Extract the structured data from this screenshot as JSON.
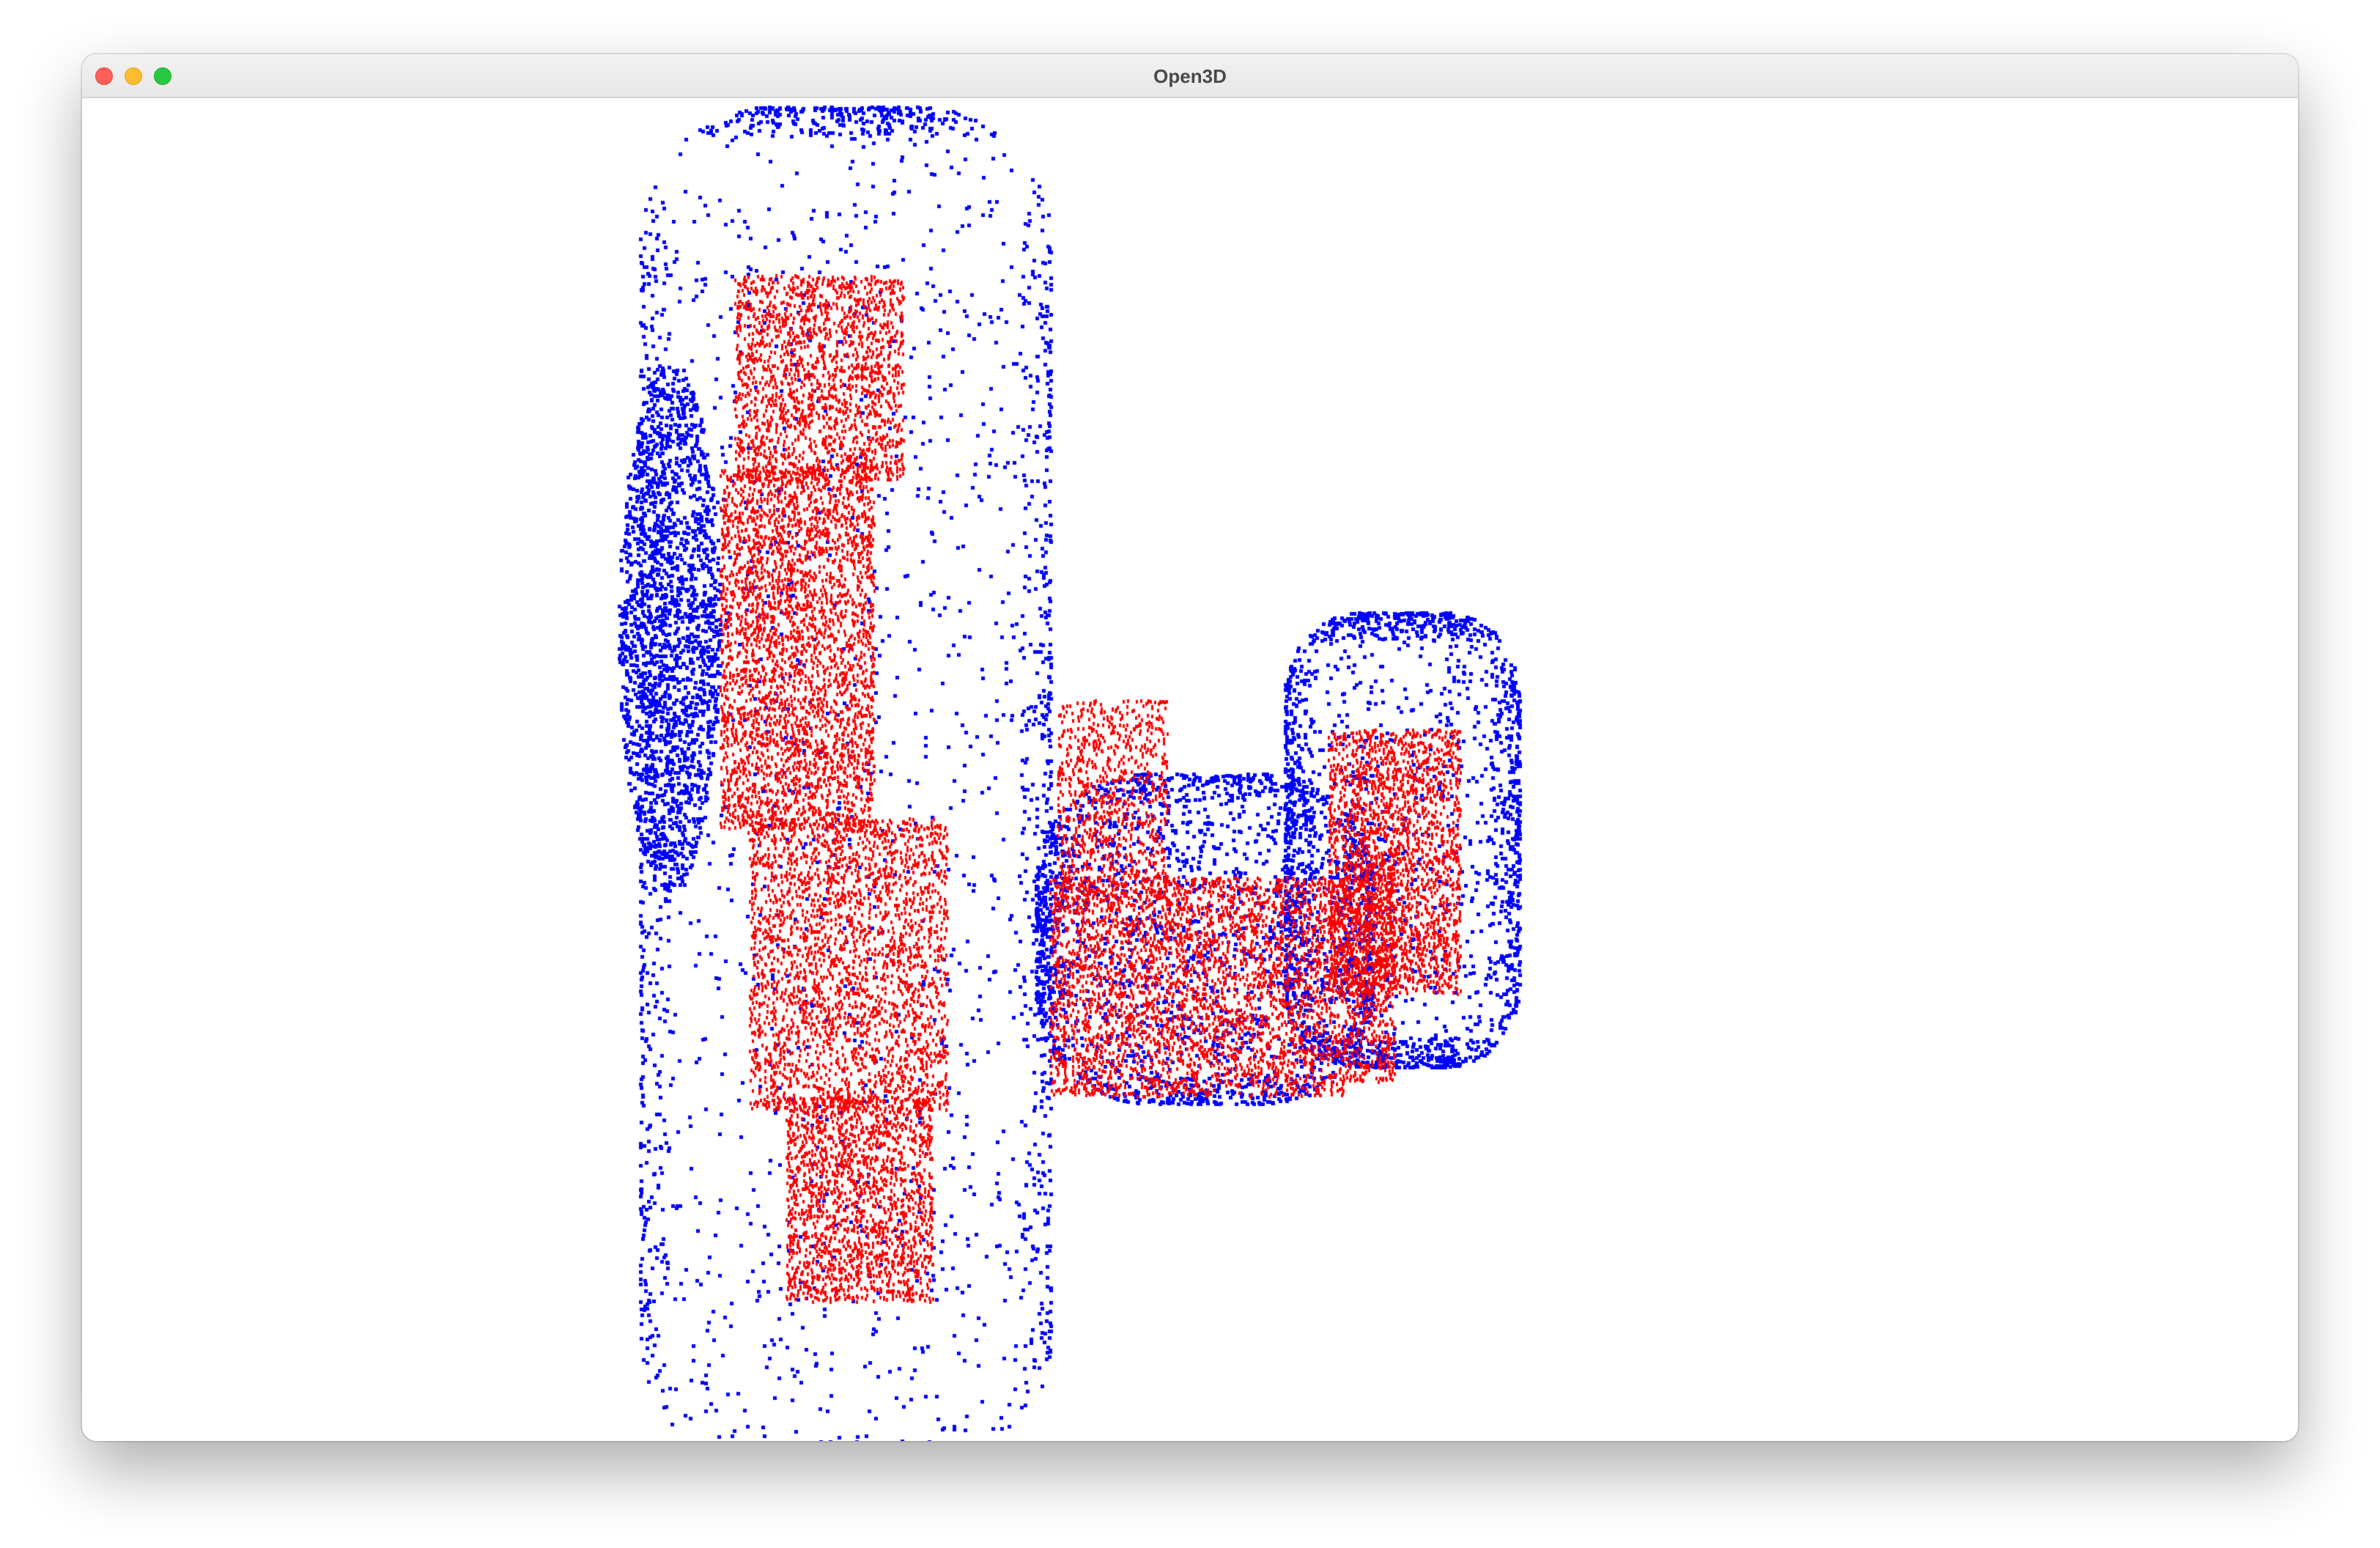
{
  "window": {
    "title": "Open3D",
    "buttons": {
      "close": "close-button",
      "minimize": "minimize-button",
      "zoom": "zoom-button"
    }
  },
  "viewport": {
    "background": "#ffffff",
    "point_clouds": [
      {
        "color": "#0000ff"
      },
      {
        "color": "#ff0000"
      }
    ]
  }
}
